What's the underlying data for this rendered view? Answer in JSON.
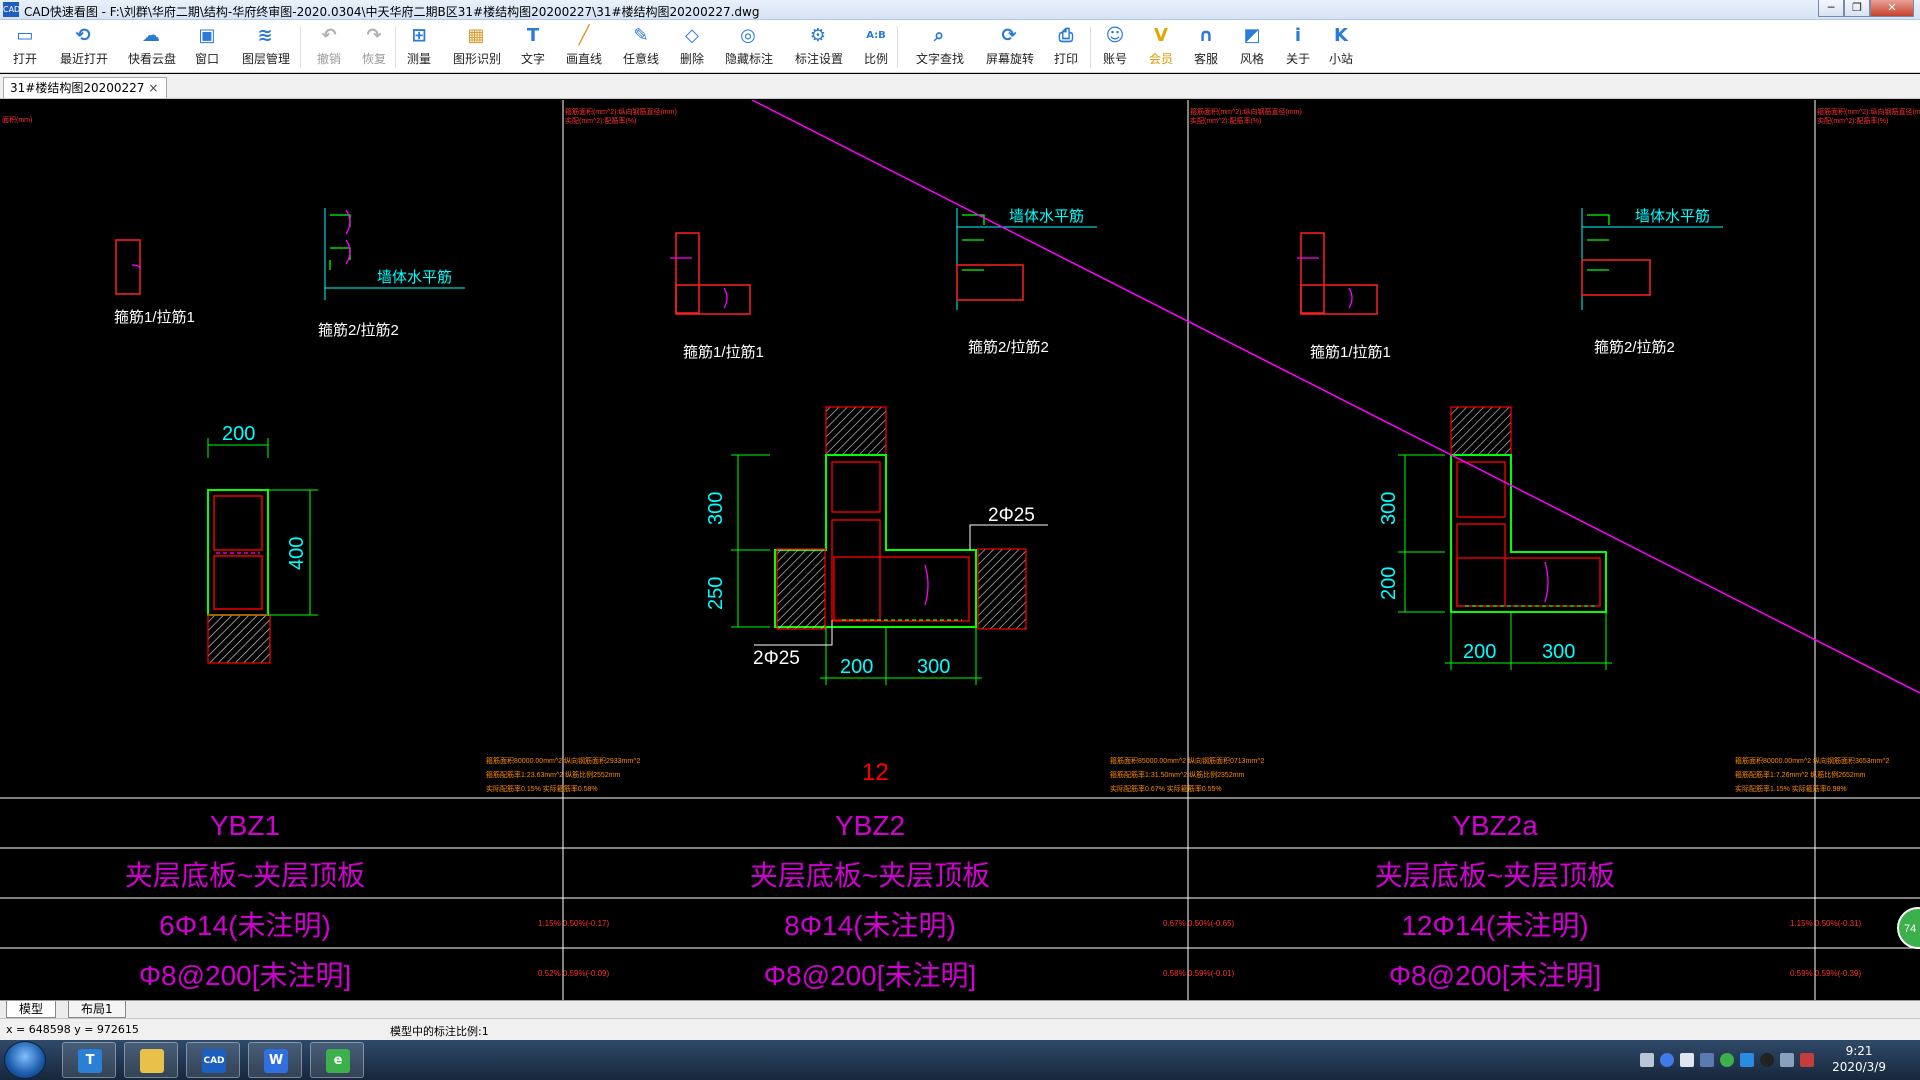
{
  "window": {
    "app_icon_text": "CAD",
    "title": "CAD快速看图 - F:\\刘群\\华府二期\\结构-华府终审图-2020.0304\\中天华府二期B区31#楼结构图20200227\\31#楼结构图20200227.dwg",
    "controls": [
      "─",
      "❐",
      "✕"
    ]
  },
  "toolbar": [
    {
      "id": "open",
      "label": "打开",
      "icon": "folder-open-icon",
      "enabled": true
    },
    {
      "id": "recent",
      "label": "最近打开",
      "icon": "recent-icon",
      "enabled": true
    },
    {
      "id": "cloud",
      "label": "快看云盘",
      "icon": "cloud-icon",
      "enabled": true
    },
    {
      "id": "window",
      "label": "窗口",
      "icon": "window-icon",
      "enabled": true
    },
    {
      "id": "layers",
      "label": "图层管理",
      "icon": "layers-icon",
      "enabled": true
    },
    {
      "id": "undo",
      "label": "撤销",
      "icon": "undo-icon",
      "enabled": false
    },
    {
      "id": "redo",
      "label": "恢复",
      "icon": "redo-icon",
      "enabled": false
    },
    {
      "id": "measure",
      "label": "测量",
      "icon": "measure-icon",
      "enabled": true
    },
    {
      "id": "recognize",
      "label": "图形识别",
      "icon": "shape-recognize-icon",
      "enabled": true
    },
    {
      "id": "text",
      "label": "文字",
      "icon": "text-icon",
      "enabled": true
    },
    {
      "id": "line",
      "label": "画直线",
      "icon": "line-icon",
      "enabled": true
    },
    {
      "id": "freeline",
      "label": "任意线",
      "icon": "pencil-icon",
      "enabled": true
    },
    {
      "id": "delete",
      "label": "删除",
      "icon": "eraser-icon",
      "enabled": true
    },
    {
      "id": "hidemark",
      "label": "隐藏标注",
      "icon": "eye-hide-icon",
      "enabled": true
    },
    {
      "id": "marksettings",
      "label": "标注设置",
      "icon": "mark-settings-icon",
      "enabled": true
    },
    {
      "id": "scale",
      "label": "比例",
      "icon": "scale-ab-icon",
      "enabled": true
    },
    {
      "id": "textsearch",
      "label": "文字查找",
      "icon": "text-search-icon",
      "enabled": true
    },
    {
      "id": "rotate",
      "label": "屏幕旋转",
      "icon": "rotate-screen-icon",
      "enabled": true
    },
    {
      "id": "print",
      "label": "打印",
      "icon": "printer-icon",
      "enabled": true
    },
    {
      "id": "account",
      "label": "账号",
      "icon": "user-icon",
      "enabled": true
    },
    {
      "id": "vip",
      "label": "会员",
      "icon": "vip-icon",
      "enabled": true
    },
    {
      "id": "service",
      "label": "客服",
      "icon": "headset-icon",
      "enabled": true
    },
    {
      "id": "style",
      "label": "风格",
      "icon": "style-icon",
      "enabled": true
    },
    {
      "id": "about",
      "label": "关于",
      "icon": "info-icon",
      "enabled": true
    },
    {
      "id": "site",
      "label": "小站",
      "icon": "k-logo-icon",
      "enabled": true
    }
  ],
  "document_tab": {
    "label": "31#楼结构图20200227",
    "close": "×"
  },
  "drawing": {
    "columns": [
      {
        "id": "YBZ1",
        "stirrup_label_1": "箍筋1/拉筋1",
        "stirrup_label_2": "箍筋2/拉筋2",
        "wall_label": "墙体水平筋",
        "dims": [
          "200",
          "400"
        ],
        "name": "YBZ1",
        "floor": "夹层底板~夹层顶板",
        "longitudinal": "6Φ14(未注明)",
        "hoop": "Φ8@200[未注明]",
        "ratio_row3": "1.15% 0.50%(-0.17)",
        "ratio_row4": "0.52% 0.59%(-0.09)"
      },
      {
        "id": "YBZ2",
        "stirrup_label_1": "箍筋1/拉筋1",
        "stirrup_label_2": "箍筋2/拉筋2",
        "wall_label": "墙体水平筋",
        "dims": [
          "300",
          "250",
          "200",
          "300"
        ],
        "rebar_labels": [
          "2Φ25",
          "2Φ25"
        ],
        "number": "12",
        "name": "YBZ2",
        "floor": "夹层底板~夹层顶板",
        "longitudinal": "8Φ14(未注明)",
        "hoop": "Φ8@200[未注明]",
        "ratio_row3": "0.67% 0.50%(-0.65)",
        "ratio_row4": "0.58% 0.59%(-0.01)",
        "notes": [
          "箍筋面积80000.00mm^2 纵向钢筋面积2933mm^2",
          "箍筋配筋率1:23.63mm^2 纵筋比例2552mm",
          "实际配筋率0.15%  实际箍筋率0.58%"
        ]
      },
      {
        "id": "YBZ2a",
        "stirrup_label_1": "箍筋1/拉筋1",
        "stirrup_label_2": "箍筋2/拉筋2",
        "wall_label": "墙体水平筋",
        "dims": [
          "300",
          "200",
          "200",
          "300"
        ],
        "name": "YBZ2a",
        "floor": "夹层底板~夹层顶板",
        "longitudinal": "12Φ14(未注明)",
        "hoop": "Φ8@200[未注明]",
        "ratio_row3": "1.15% 0.50%(-0.31)",
        "ratio_row4": "0.59% 0.59%(-0.39)",
        "notes": [
          "箍筋面积85000.00mm^2 纵向钢筋面积0713mm^2",
          "箍筋配筋率1:31.50mm^2 纵筋比例2352mm",
          "实际配筋率0.67%  实际箍筋率0.55%"
        ]
      }
    ],
    "right_notes": [
      "箍筋面积80000.00mm^2 纵向钢筋面积3653mm^2",
      "箍筋配筋率1:7.26mm^2 纵筋比例2652mm",
      "实际配筋率1.15%  实际箍筋率0.98%"
    ],
    "header_note_left": "面积(mm)",
    "header_notes": [
      "箍筋面积(mm^2):纵向钢筋直径(mm)",
      "实配(mm^2):配筋率(%)"
    ]
  },
  "float_badge": "74",
  "layout_tabs": [
    "模型",
    "布局1"
  ],
  "status": {
    "coords": "x = 648598  y = 972615",
    "scale_text": "模型中的标注比例:1"
  },
  "taskbar": {
    "apps": [
      {
        "name": "text-app",
        "glyph": "T",
        "color": "#2b7fd4"
      },
      {
        "name": "folder-app",
        "glyph": "",
        "color": "#e8c04a"
      },
      {
        "name": "cad-app",
        "glyph": "CAD",
        "color": "#1d5fbf"
      },
      {
        "name": "wps-app",
        "glyph": "W",
        "color": "#2f6fe0"
      },
      {
        "name": "browser-app",
        "glyph": "e",
        "color": "#3cb04a"
      }
    ],
    "time": "9:21",
    "date": "2020/3/9"
  },
  "colors": {
    "canvas": "#000000",
    "magenta": "#ff00ff",
    "red": "#ff0000",
    "green": "#00ff00",
    "cyan": "#00ffff",
    "white": "#ffffff",
    "title_purple": "#d000d0"
  }
}
